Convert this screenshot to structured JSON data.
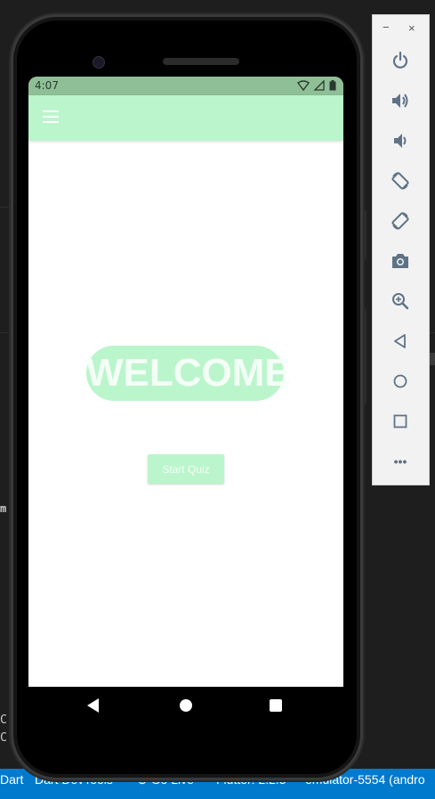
{
  "device": {
    "status_time": "4:07",
    "status_icons": "▾◢▮"
  },
  "app": {
    "welcome_text": "WELCOME",
    "start_button_label": "Start Quiz",
    "accent_color": "#bbf5cc"
  },
  "emulator_panel": {
    "minimize": "−",
    "close": "×",
    "tools": [
      "power-icon",
      "volume-up-icon",
      "volume-down-icon",
      "rotate-left-icon",
      "rotate-right-icon",
      "camera-icon",
      "zoom-icon",
      "back-icon",
      "home-icon",
      "overview-icon",
      "more-icon"
    ],
    "more_label": "•••"
  },
  "ide": {
    "left_chars": [
      "m",
      "C",
      "C"
    ],
    "status_items": [
      "Dart",
      "Dart DevTools",
      "Go Live",
      "Flutter: 2.2.3",
      "emulator-5554 (andro"
    ]
  }
}
